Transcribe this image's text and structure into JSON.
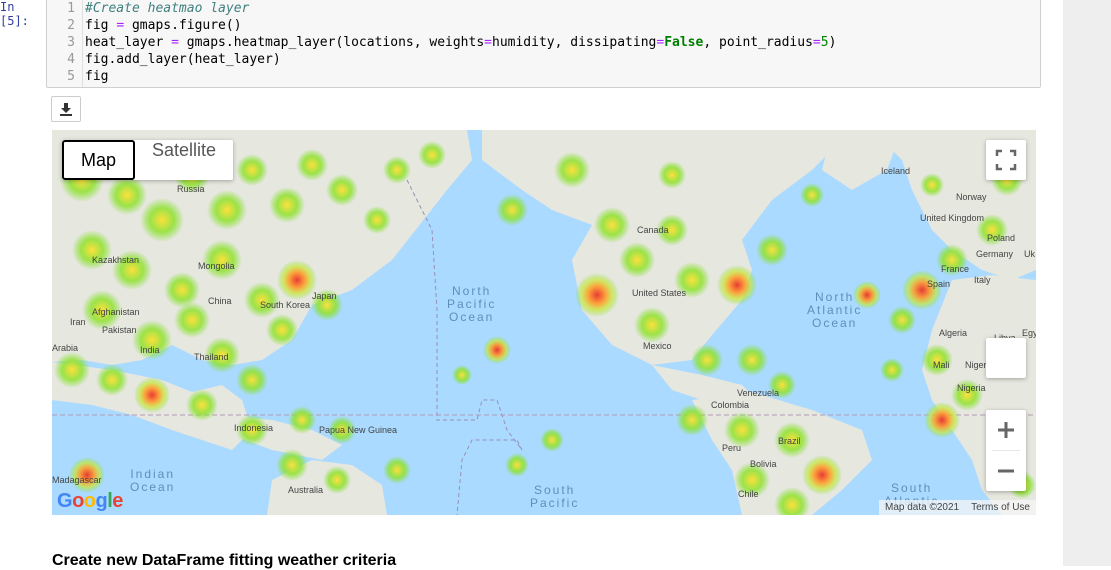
{
  "cell": {
    "prompt": "In [5]:",
    "lines": [
      {
        "n": "1",
        "text": "#Create heatmao layer"
      },
      {
        "n": "2",
        "text": "fig = gmaps.figure()"
      },
      {
        "n": "3",
        "text": "heat_layer = gmaps.heatmap_layer(locations, weights=humidity, dissipating=False, point_radius=5)"
      },
      {
        "n": "4",
        "text": "fig.add_layer(heat_layer)"
      },
      {
        "n": "5",
        "text": "fig"
      }
    ]
  },
  "toolbar": {
    "download_icon": "download-icon"
  },
  "map": {
    "map_type_buttons": [
      "Map",
      "Satellite"
    ],
    "fullscreen_icon": "fullscreen-icon",
    "zoom_in": "+",
    "zoom_out": "−",
    "google_logo": "Google",
    "attribution": "Map data ©2021",
    "terms": "Terms of Use",
    "colors": {
      "water": "#aadaff",
      "land": "#e8e8e0",
      "heat_low": "#7fe02a",
      "heat_mid": "#ffe033",
      "heat_high": "#e8322a"
    },
    "place_labels": [
      "Russia",
      "Kazakhstan",
      "Mongolia",
      "China",
      "South Korea",
      "Japan",
      "Afghanistan",
      "Iran",
      "Pakistan",
      "Arabia",
      "India",
      "Thailand",
      "Indonesia",
      "Papua New Guinea",
      "Australia",
      "Madagascar",
      "Canada",
      "United States",
      "Mexico",
      "Venezuela",
      "Colombia",
      "Peru",
      "Brazil",
      "Bolivia",
      "Chile",
      "Iceland",
      "Norway",
      "United Kingdom",
      "Poland",
      "Germany",
      "France",
      "Spain",
      "Italy",
      "Algeria",
      "Libya",
      "Mali",
      "Niger",
      "Nigeria",
      "Uk",
      "Egy"
    ],
    "ocean_labels": [
      "North Pacific Ocean",
      "North Atlantic Ocean",
      "Indian Ocean",
      "South Pacific",
      "South Atlantic"
    ]
  },
  "next_heading": "Create new DataFrame fitting weather criteria"
}
